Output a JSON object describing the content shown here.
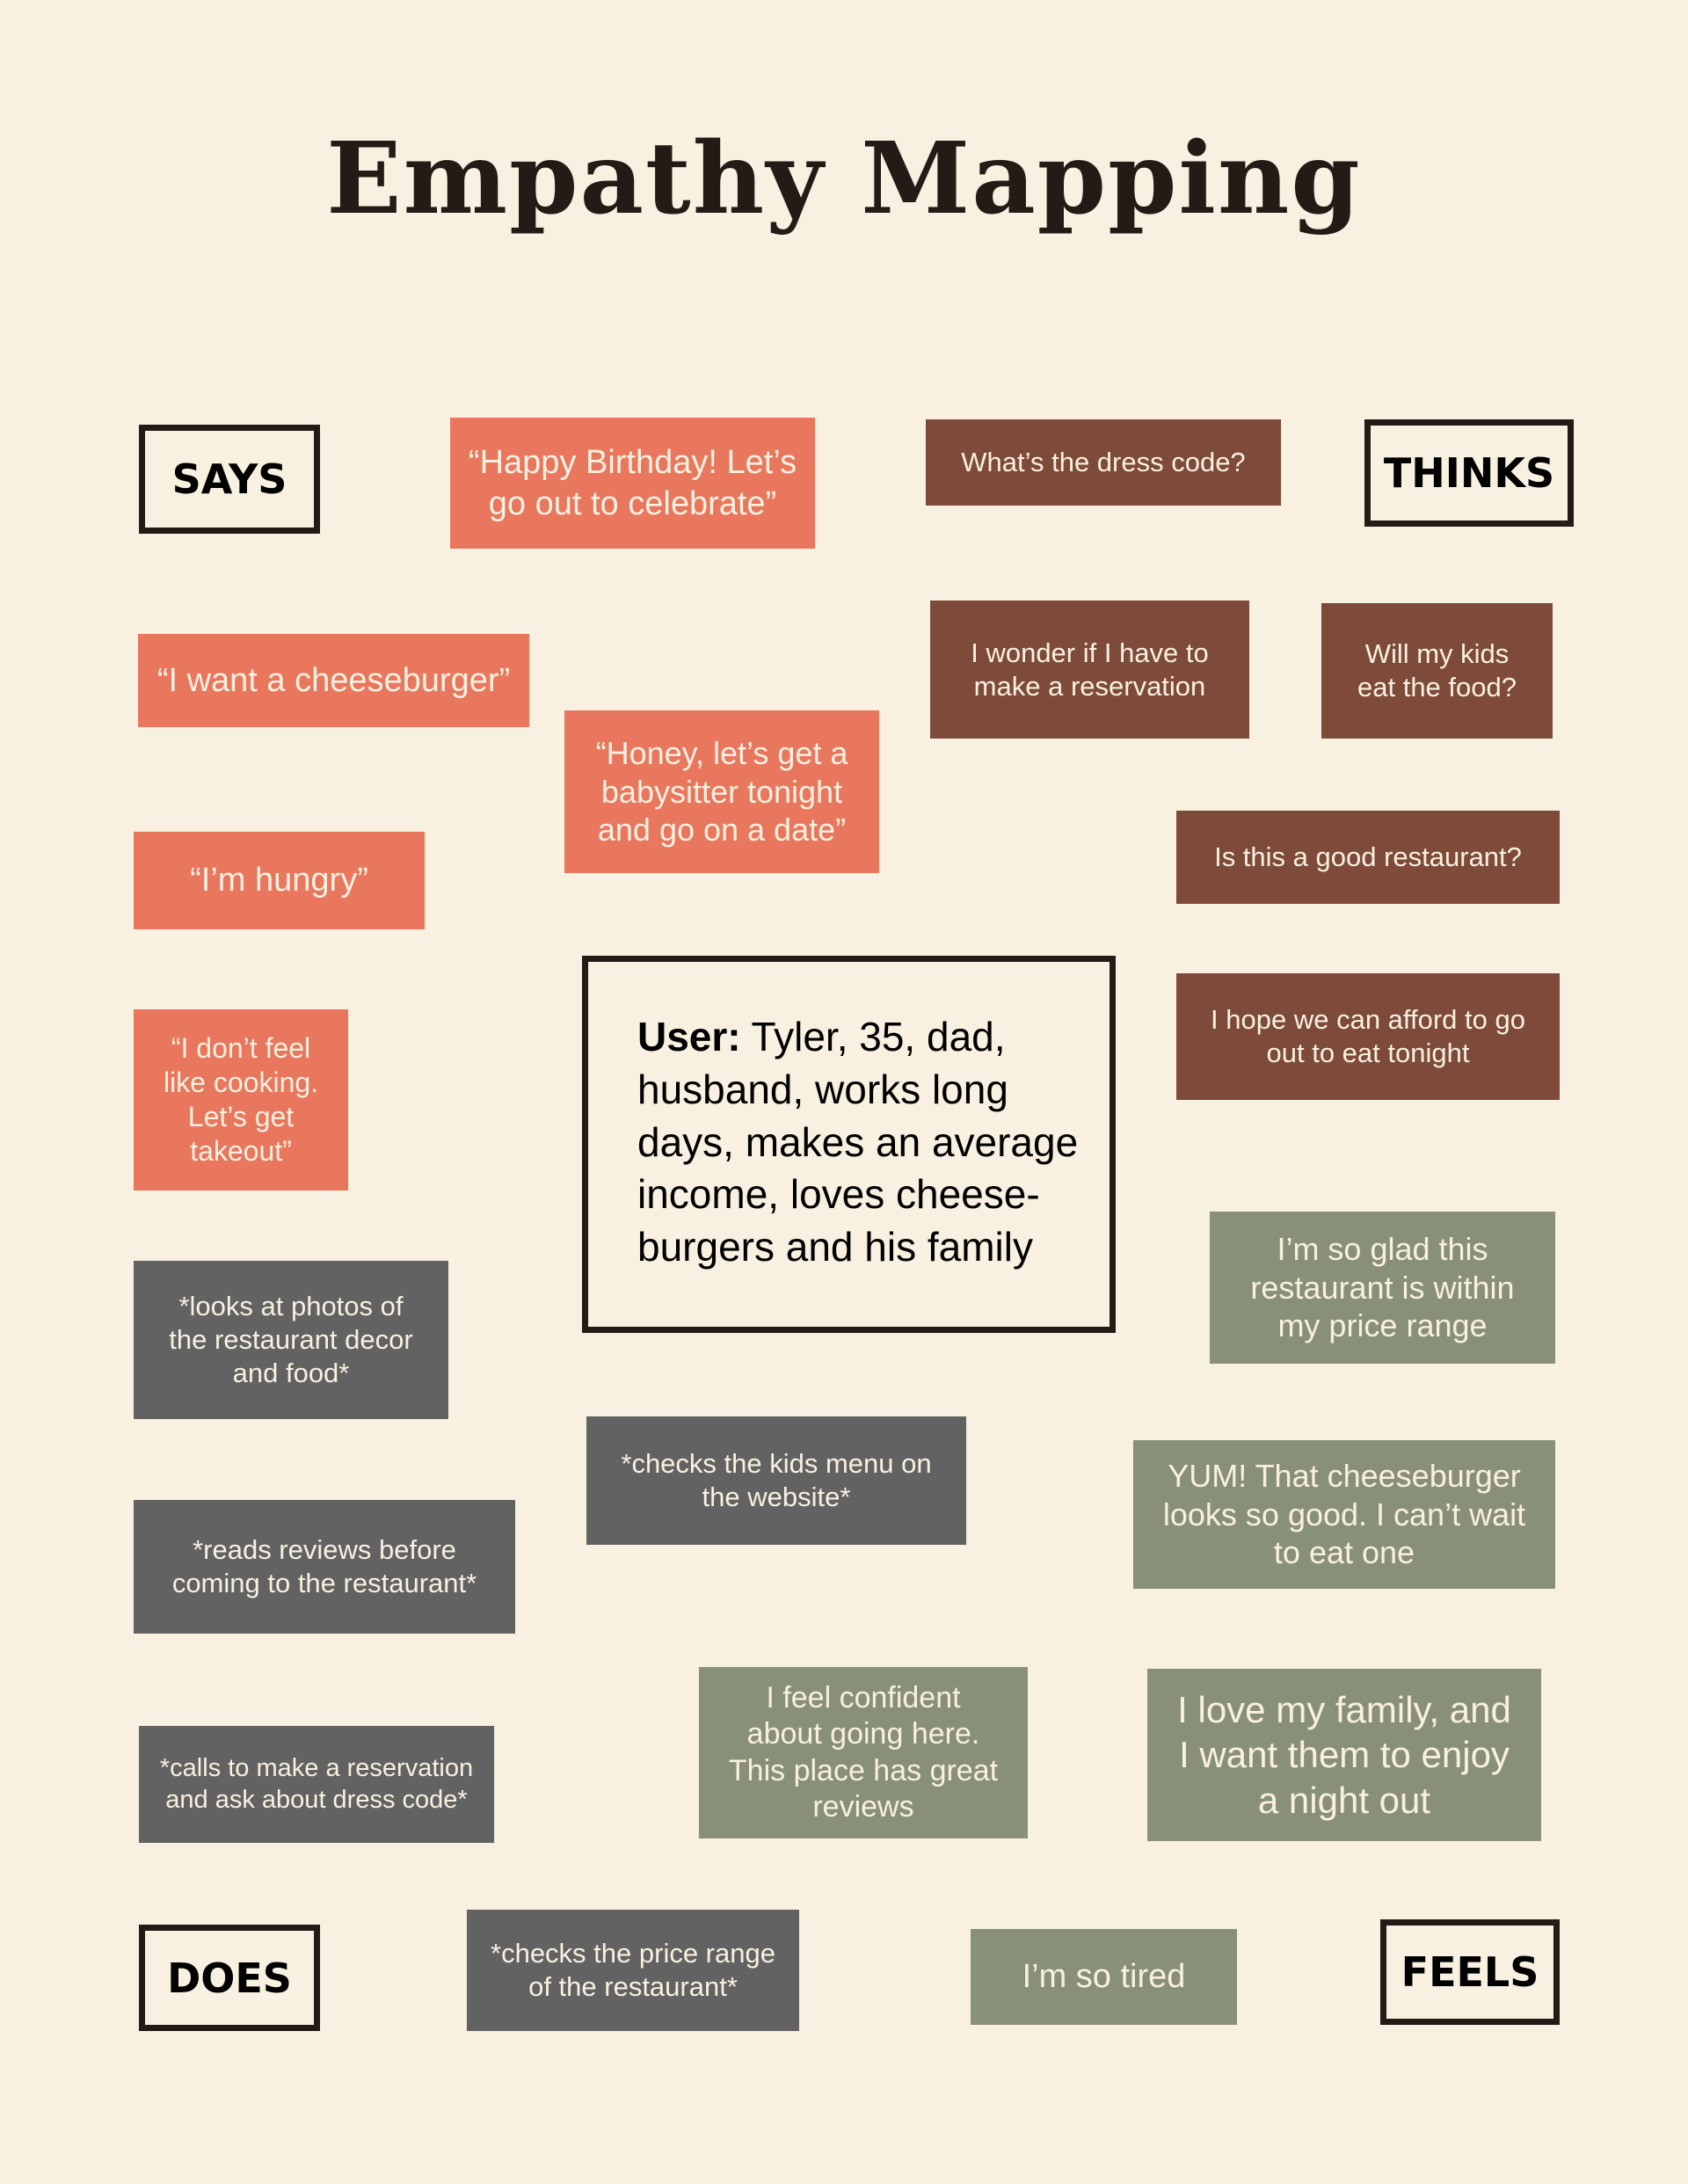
{
  "title": "Empathy Mapping",
  "quadrant_labels": {
    "says": "SAYS",
    "thinks": "THINKS",
    "does": "DOES",
    "feels": "FEELS"
  },
  "user": {
    "label": "User:",
    "description": " Tyler, 35, dad, husband, works long days, makes an average income, loves cheese-burgers and his family"
  },
  "says": [
    "“Happy Birthday! Let’s\ngo out to celebrate”",
    "“I want a cheeseburger”",
    "“Honey, let’s get a\nbabysitter tonight\nand go on a date”",
    "“I’m hungry”",
    "“I don’t feel\nlike cooking.\nLet’s get\ntakeout”"
  ],
  "thinks": [
    "What’s the dress code?",
    "I wonder if I have to\nmake a reservation",
    "Will my kids\neat the food?",
    "Is this a good restaurant?",
    "I hope we can afford to go\nout to eat tonight"
  ],
  "does": [
    "*looks at photos of\nthe restaurant decor\nand food*",
    "*checks the kids menu on\nthe website*",
    "*reads reviews before\ncoming to the restaurant*",
    "*calls to make a reservation\nand ask about dress code*",
    "*checks the price range\nof the restaurant*"
  ],
  "feels": [
    "I’m so glad this\nrestaurant is within\nmy price range",
    "YUM! That cheeseburger\nlooks so good. I can’t wait\nto eat one",
    "I feel confident\nabout going here.\nThis place has great\nreviews",
    "I love my family, and\nI want them to enjoy\na night out",
    "I’m so tired"
  ],
  "colors": {
    "background": "#f8f0e0",
    "says": "#e8775d",
    "thinks": "#7e4a39",
    "does": "#626262",
    "feels": "#89907a",
    "ink": "#231c16"
  }
}
